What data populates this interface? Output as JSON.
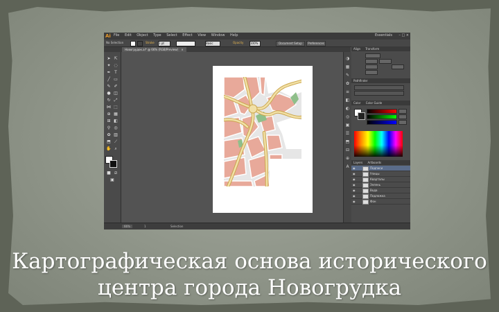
{
  "title": {
    "line1": "Картографическая основа исторического",
    "line2": "центра города Новогрудка"
  },
  "app": {
    "logo": "Ai",
    "menu": [
      "File",
      "Edit",
      "Object",
      "Type",
      "Select",
      "Effect",
      "View",
      "Window",
      "Help"
    ],
    "workspace": "Essentials",
    "window_buttons": "– □ ×"
  },
  "control_bar": {
    "selection_label": "No Selection",
    "stroke_label": "Stroke",
    "stroke_value": "1 pt",
    "style_value": "Basic",
    "opacity_label": "Opacity",
    "opacity_value": "100%",
    "document_setup": "Document Setup",
    "preferences": "Preferences"
  },
  "document_tab": {
    "label": "Новогрудок.ai* @ 66% (RGB/Preview)",
    "close": "×"
  },
  "status_bar": {
    "zoom": "66%",
    "page": "1",
    "tool": "Selection"
  },
  "panels": {
    "align_tab": "Align",
    "transform_tab": "Transform",
    "pathfinder_tab": "Pathfinder",
    "color_tab": "Color",
    "guide_tab": "Color Guide",
    "layers_tab": "Layers",
    "artboards_tab": "Artboards"
  },
  "layers": [
    {
      "name": "Подписи"
    },
    {
      "name": "Улицы"
    },
    {
      "name": "Кварталы"
    },
    {
      "name": "Зелень"
    },
    {
      "name": "Вода"
    },
    {
      "name": "Подложка"
    },
    {
      "name": "Фон"
    }
  ],
  "colors": {
    "map_blocks": "#e8a99a",
    "map_roads": "#f1e0a6",
    "map_road_edges": "#caa44a",
    "map_green": "#8fbf8a",
    "map_background": "#e6e6e6"
  }
}
